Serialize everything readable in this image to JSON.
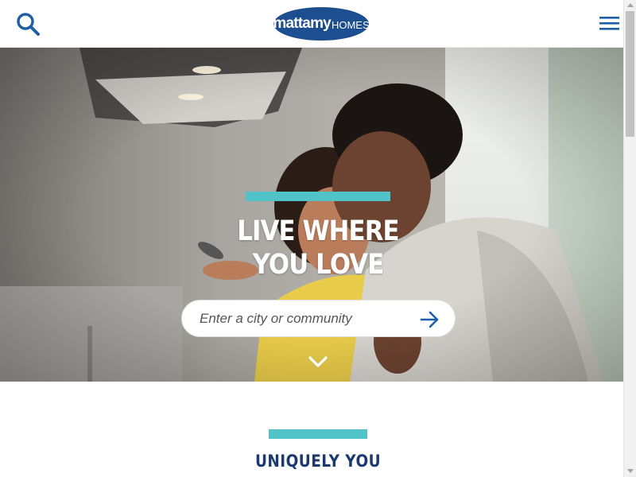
{
  "header": {
    "search_icon": "search-icon",
    "logo": {
      "brand": "mattamy",
      "suffix": "HOMES",
      "color": "#1d4e8f"
    },
    "menu_icon": "hamburger-icon"
  },
  "hero": {
    "title_line1": "LIVE WHERE",
    "title_line2": "YOU LOVE",
    "accent_color": "#4fc3c8",
    "search": {
      "placeholder": "Enter a city or community",
      "value": "",
      "submit_icon": "arrow-right-icon"
    },
    "scroll_icon": "chevron-down-icon"
  },
  "section": {
    "title": "UNIQUELY YOU",
    "title_color": "#1d3a6e"
  },
  "colors": {
    "brand_blue": "#1d4e8f",
    "accent_teal": "#4fc3c8"
  }
}
